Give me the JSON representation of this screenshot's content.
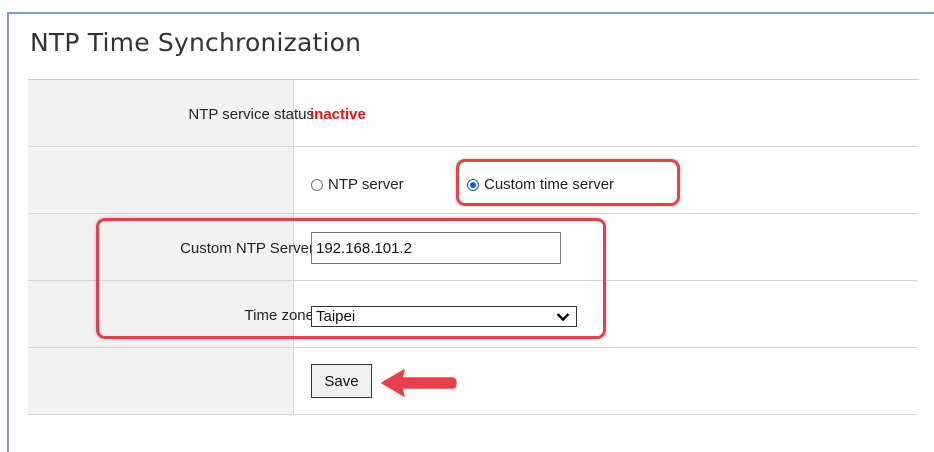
{
  "page": {
    "title": "NTP Time Synchronization"
  },
  "status": {
    "label": "NTP service status",
    "value": "inactive",
    "value_color": "#ee1111"
  },
  "mode": {
    "options": [
      {
        "label": "NTP server",
        "checked": false
      },
      {
        "label": "Custom time server",
        "checked": true
      }
    ]
  },
  "custom_server": {
    "label": "Custom NTP Server",
    "value": "192.168.101.2"
  },
  "timezone": {
    "label": "Time zone",
    "selected": "Taipei"
  },
  "actions": {
    "save_label": "Save"
  },
  "annotations": {
    "highlight_color": "#e8404a",
    "arrow_color": "#e8404a",
    "radio_accent": "#0b62d6"
  }
}
